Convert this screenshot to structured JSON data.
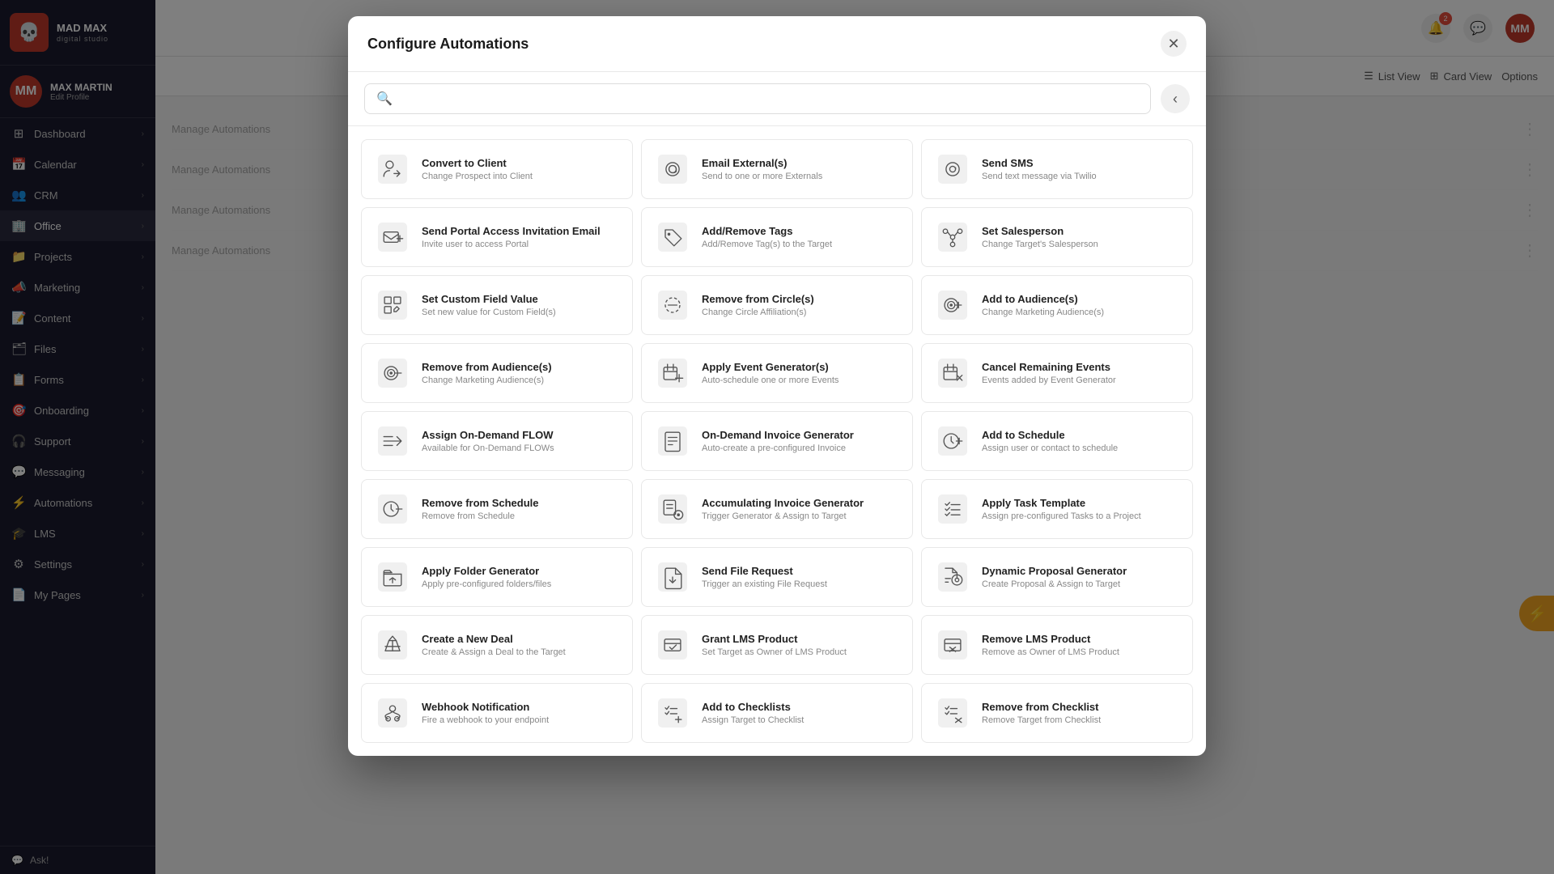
{
  "app": {
    "name": "MAD MAX",
    "sub": "digital studio",
    "logo_emoji": "💀"
  },
  "user": {
    "name": "MAX MARTIN",
    "link": "Edit Profile",
    "initials": "MM"
  },
  "sidebar": {
    "items": [
      {
        "id": "dashboard",
        "label": "Dashboard",
        "icon": "⊞",
        "has_arrow": true
      },
      {
        "id": "calendar",
        "label": "Calendar",
        "icon": "📅",
        "has_arrow": true
      },
      {
        "id": "crm",
        "label": "CRM",
        "icon": "👥",
        "has_arrow": true
      },
      {
        "id": "office",
        "label": "Office",
        "icon": "🏢",
        "has_arrow": true,
        "active": true
      },
      {
        "id": "projects",
        "label": "Projects",
        "icon": "📁",
        "has_arrow": true
      },
      {
        "id": "marketing",
        "label": "Marketing",
        "icon": "📣",
        "has_arrow": true
      },
      {
        "id": "content",
        "label": "Content",
        "icon": "📝",
        "has_arrow": true
      },
      {
        "id": "files",
        "label": "Files",
        "icon": "🗂",
        "has_arrow": true
      },
      {
        "id": "forms",
        "label": "Forms",
        "icon": "📋",
        "has_arrow": true
      },
      {
        "id": "onboarding",
        "label": "Onboarding",
        "icon": "🎯",
        "has_arrow": true
      },
      {
        "id": "support",
        "label": "Support",
        "icon": "🎧",
        "has_arrow": true
      },
      {
        "id": "messaging",
        "label": "Messaging",
        "icon": "💬",
        "has_arrow": true
      },
      {
        "id": "automations",
        "label": "Automations",
        "icon": "⚡",
        "has_arrow": true
      },
      {
        "id": "lms",
        "label": "LMS",
        "icon": "🎓",
        "has_arrow": true
      },
      {
        "id": "settings",
        "label": "Settings",
        "icon": "⚙",
        "has_arrow": true
      },
      {
        "id": "my-pages",
        "label": "My Pages",
        "icon": "📄",
        "has_arrow": true
      }
    ],
    "ask": "Ask!"
  },
  "modal": {
    "title": "Configure Automations",
    "search_placeholder": "",
    "cards": [
      {
        "id": "convert-to-client",
        "title": "Convert to Client",
        "desc": "Change Prospect into Client",
        "icon_type": "person-arrows"
      },
      {
        "id": "email-externals",
        "title": "Email External(s)",
        "desc": "Send to one or more Externals",
        "icon_type": "at-sign"
      },
      {
        "id": "send-sms",
        "title": "Send SMS",
        "desc": "Send text message via Twilio",
        "icon_type": "at-circle"
      },
      {
        "id": "send-portal-access",
        "title": "Send Portal Access Invitation Email",
        "desc": "Invite user to access Portal",
        "icon_type": "envelope-plus"
      },
      {
        "id": "add-remove-tags",
        "title": "Add/Remove Tags",
        "desc": "Add/Remove Tag(s) to the Target",
        "icon_type": "tag"
      },
      {
        "id": "set-salesperson",
        "title": "Set Salesperson",
        "desc": "Change Target's Salesperson",
        "icon_type": "nodes"
      },
      {
        "id": "set-custom-field",
        "title": "Set Custom Field Value",
        "desc": "Set new value for Custom Field(s)",
        "icon_type": "grid-edit"
      },
      {
        "id": "remove-from-circle",
        "title": "Remove from Circle(s)",
        "desc": "Change Circle Affiliation(s)",
        "icon_type": "circle-dash"
      },
      {
        "id": "add-to-audiences",
        "title": "Add to Audience(s)",
        "desc": "Change Marketing Audience(s)",
        "icon_type": "target-plus"
      },
      {
        "id": "remove-from-audiences",
        "title": "Remove from Audience(s)",
        "desc": "Change Marketing Audience(s)",
        "icon_type": "target-minus"
      },
      {
        "id": "apply-event-generator",
        "title": "Apply Event Generator(s)",
        "desc": "Auto-schedule one or more Events",
        "icon_type": "calendar-plus"
      },
      {
        "id": "cancel-remaining-events",
        "title": "Cancel Remaining Events",
        "desc": "Events added by Event Generator",
        "icon_type": "calendar-x"
      },
      {
        "id": "assign-on-demand-flow",
        "title": "Assign On-Demand FLOW",
        "desc": "Available for On-Demand FLOWs",
        "icon_type": "arrows-right"
      },
      {
        "id": "on-demand-invoice",
        "title": "On-Demand Invoice Generator",
        "desc": "Auto-create a pre-configured Invoice",
        "icon_type": "invoice"
      },
      {
        "id": "add-to-schedule",
        "title": "Add to Schedule",
        "desc": "Assign user or contact to schedule",
        "icon_type": "clock-plus"
      },
      {
        "id": "remove-from-schedule",
        "title": "Remove from Schedule",
        "desc": "Remove from Schedule",
        "icon_type": "clock-minus"
      },
      {
        "id": "accumulating-invoice",
        "title": "Accumulating Invoice Generator",
        "desc": "Trigger Generator & Assign to Target",
        "icon_type": "invoice-gear"
      },
      {
        "id": "apply-task-template",
        "title": "Apply Task Template",
        "desc": "Assign pre-configured Tasks to a Project",
        "icon_type": "checklist"
      },
      {
        "id": "apply-folder-generator",
        "title": "Apply Folder Generator",
        "desc": "Apply pre-configured folders/files",
        "icon_type": "folder-arrows"
      },
      {
        "id": "send-file-request",
        "title": "Send File Request",
        "desc": "Trigger an existing File Request",
        "icon_type": "file-arrow"
      },
      {
        "id": "dynamic-proposal",
        "title": "Dynamic Proposal Generator",
        "desc": "Create Proposal & Assign to Target",
        "icon_type": "gear-doc"
      },
      {
        "id": "create-new-deal",
        "title": "Create a New Deal",
        "desc": "Create & Assign a Deal to the Target",
        "icon_type": "deal"
      },
      {
        "id": "grant-lms-product",
        "title": "Grant LMS Product",
        "desc": "Set Target as Owner of LMS Product",
        "icon_type": "lms-grant"
      },
      {
        "id": "remove-lms-product",
        "title": "Remove LMS Product",
        "desc": "Remove as Owner of LMS Product",
        "icon_type": "lms-remove"
      },
      {
        "id": "webhook-notification",
        "title": "Webhook Notification",
        "desc": "Fire a webhook to your endpoint",
        "icon_type": "webhook"
      },
      {
        "id": "add-to-checklists",
        "title": "Add to Checklists",
        "desc": "Assign Target to Checklist",
        "icon_type": "checklist-add"
      },
      {
        "id": "remove-from-checklist",
        "title": "Remove from Checklist",
        "desc": "Remove Target from Checklist",
        "icon_type": "checklist-remove"
      }
    ]
  },
  "header": {
    "list_view": "List View",
    "card_view": "Card View",
    "options": "Options",
    "manage_automations": "Manage Automations"
  }
}
